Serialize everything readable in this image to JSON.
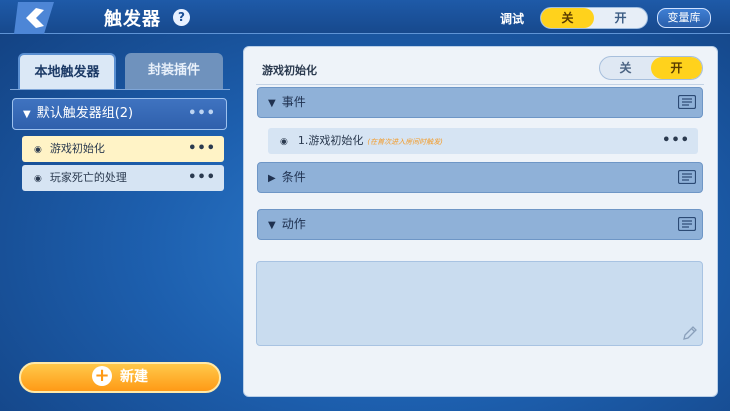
{
  "header": {
    "title": "触发器",
    "help_icon": "?",
    "debug_label": "调试",
    "debug_off": "关",
    "debug_on": "开",
    "debug_state": "off",
    "variable_library": "变量库"
  },
  "left_panel": {
    "tabs": [
      {
        "label": "本地触发器",
        "active": true
      },
      {
        "label": "封装插件",
        "active": false
      }
    ],
    "group": {
      "label": "默认触发器组(2)",
      "more": "•••"
    },
    "triggers": [
      {
        "label": "游戏初始化",
        "selected": true,
        "more": "•••"
      },
      {
        "label": "玩家死亡的处理",
        "selected": false,
        "more": "•••"
      }
    ],
    "new_button": "新建"
  },
  "main_panel": {
    "trigger_name": "游戏初始化",
    "toggle_off": "关",
    "toggle_on": "开",
    "toggle_state": "on",
    "sections": {
      "event": "事件",
      "condition": "条件",
      "action": "动作"
    },
    "event_item": {
      "label": "1.游戏初始化",
      "note": "(在首次进入房间时触发)",
      "more": "•••"
    }
  },
  "colors": {
    "accent_yellow": "#ffd21c",
    "button_orange": "#ff9a16",
    "section_blue": "#8fb1d8"
  }
}
